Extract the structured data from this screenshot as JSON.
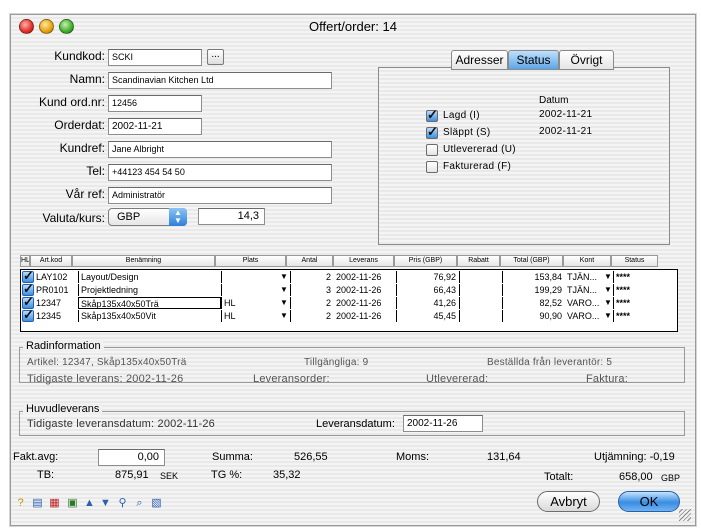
{
  "window": {
    "title": "Offert/order: 14"
  },
  "form": {
    "kundkod": {
      "label": "Kundkod:",
      "value": "SCKI"
    },
    "namn": {
      "label": "Namn:",
      "value": "Scandinavian Kitchen Ltd"
    },
    "kundordnr": {
      "label": "Kund ord.nr:",
      "value": "12456"
    },
    "orderdat": {
      "label": "Orderdat:",
      "value": "2002-11-21"
    },
    "kundref": {
      "label": "Kundref:",
      "value": "Jane Albright"
    },
    "tel": {
      "label": "Tel:",
      "value": "+44123 454 54 50"
    },
    "varref": {
      "label": "Vår ref:",
      "value": "Administratör"
    },
    "valuta": {
      "label": "Valuta/kurs:",
      "currency": "GBP",
      "rate": "14,3"
    },
    "ellipsis": "..."
  },
  "tabs": [
    {
      "label": "Adresser"
    },
    {
      "label": "Status"
    },
    {
      "label": "Övrigt"
    }
  ],
  "status": {
    "datum_header": "Datum",
    "items": [
      {
        "label": "Lagd (I)",
        "checked": true,
        "date": "2002-11-21"
      },
      {
        "label": "Släppt (S)",
        "checked": true,
        "date": "2002-11-21"
      },
      {
        "label": "Utlevererad (U)",
        "checked": false,
        "date": ""
      },
      {
        "label": "Fakturerad (F)",
        "checked": false,
        "date": ""
      }
    ]
  },
  "table": {
    "headers": [
      "HL",
      "Art.kod",
      "Benämning",
      "Plats",
      "Antal",
      "Leverans",
      "Pris (GBP)",
      "Rabatt",
      "Total (GBP)",
      "Kont",
      "Status"
    ],
    "rows": [
      {
        "artkod": "LAY102",
        "benamning": "Layout/Design",
        "plats": "",
        "antal": "2",
        "leverans": "2002-11-26",
        "pris": "76,92",
        "rabatt": "",
        "total": "153,84",
        "kont": "TJÄN...",
        "status": "****"
      },
      {
        "artkod": "PR0101",
        "benamning": "Projektledning",
        "plats": "",
        "antal": "3",
        "leverans": "2002-11-26",
        "pris": "66,43",
        "rabatt": "",
        "total": "199,29",
        "kont": "TJÄN...",
        "status": "****"
      },
      {
        "artkod": "12347",
        "benamning": "Skåp135x40x50Trä",
        "plats": "HL",
        "antal": "2",
        "leverans": "2002-11-26",
        "pris": "41,26",
        "rabatt": "",
        "total": "82,52",
        "kont": "VARO...",
        "status": "****"
      },
      {
        "artkod": "12345",
        "benamning": "Skåp135x40x50Vit",
        "plats": "HL",
        "antal": "2",
        "leverans": "2002-11-26",
        "pris": "45,45",
        "rabatt": "",
        "total": "90,90",
        "kont": "VARO...",
        "status": "****"
      }
    ]
  },
  "radinformation": {
    "title": "Radinformation",
    "artikel": "Artikel: 12347, Skåp135x40x50Trä",
    "tillgangliga": "Tillgängliga: 9",
    "bestallda": "Beställda från leverantör: 5",
    "tidigaste": "Tidigaste leverans: 2002-11-26",
    "leveransorder": "Leveransorder:",
    "utlevererad": "Utlevererad:",
    "faktura": "Faktura:"
  },
  "huvudleverans": {
    "title": "Huvudleverans",
    "tidigaste": "Tidigaste leveransdatum: 2002-11-26",
    "leveransdatum_label": "Leveransdatum:",
    "leveransdatum_value": "2002-11-26"
  },
  "totals": {
    "faktavg_label": "Fakt.avg:",
    "faktavg_value": "0,00",
    "summa_label": "Summa:",
    "summa_value": "526,55",
    "moms_label": "Moms:",
    "moms_value": "131,64",
    "utjamning": "Utjämning: -0,19",
    "tb_label": "TB:",
    "tb_value": "875,91",
    "tb_unit": "SEK",
    "tg_label": "TG %:",
    "tg_value": "35,32",
    "totalt_label": "Totalt:",
    "totalt_value": "658,00",
    "totalt_unit": "GBP"
  },
  "buttons": {
    "cancel": "Avbryt",
    "ok": "OK"
  },
  "toolbar_icons": [
    "help-icon",
    "print-icon",
    "invoice-icon",
    "add-row-icon",
    "move-up-icon",
    "move-down-icon",
    "search-icon",
    "zoom-icon",
    "export-icon"
  ],
  "colors": {
    "accent": "#3a8de2",
    "tab_active": "#5ea5e6"
  }
}
